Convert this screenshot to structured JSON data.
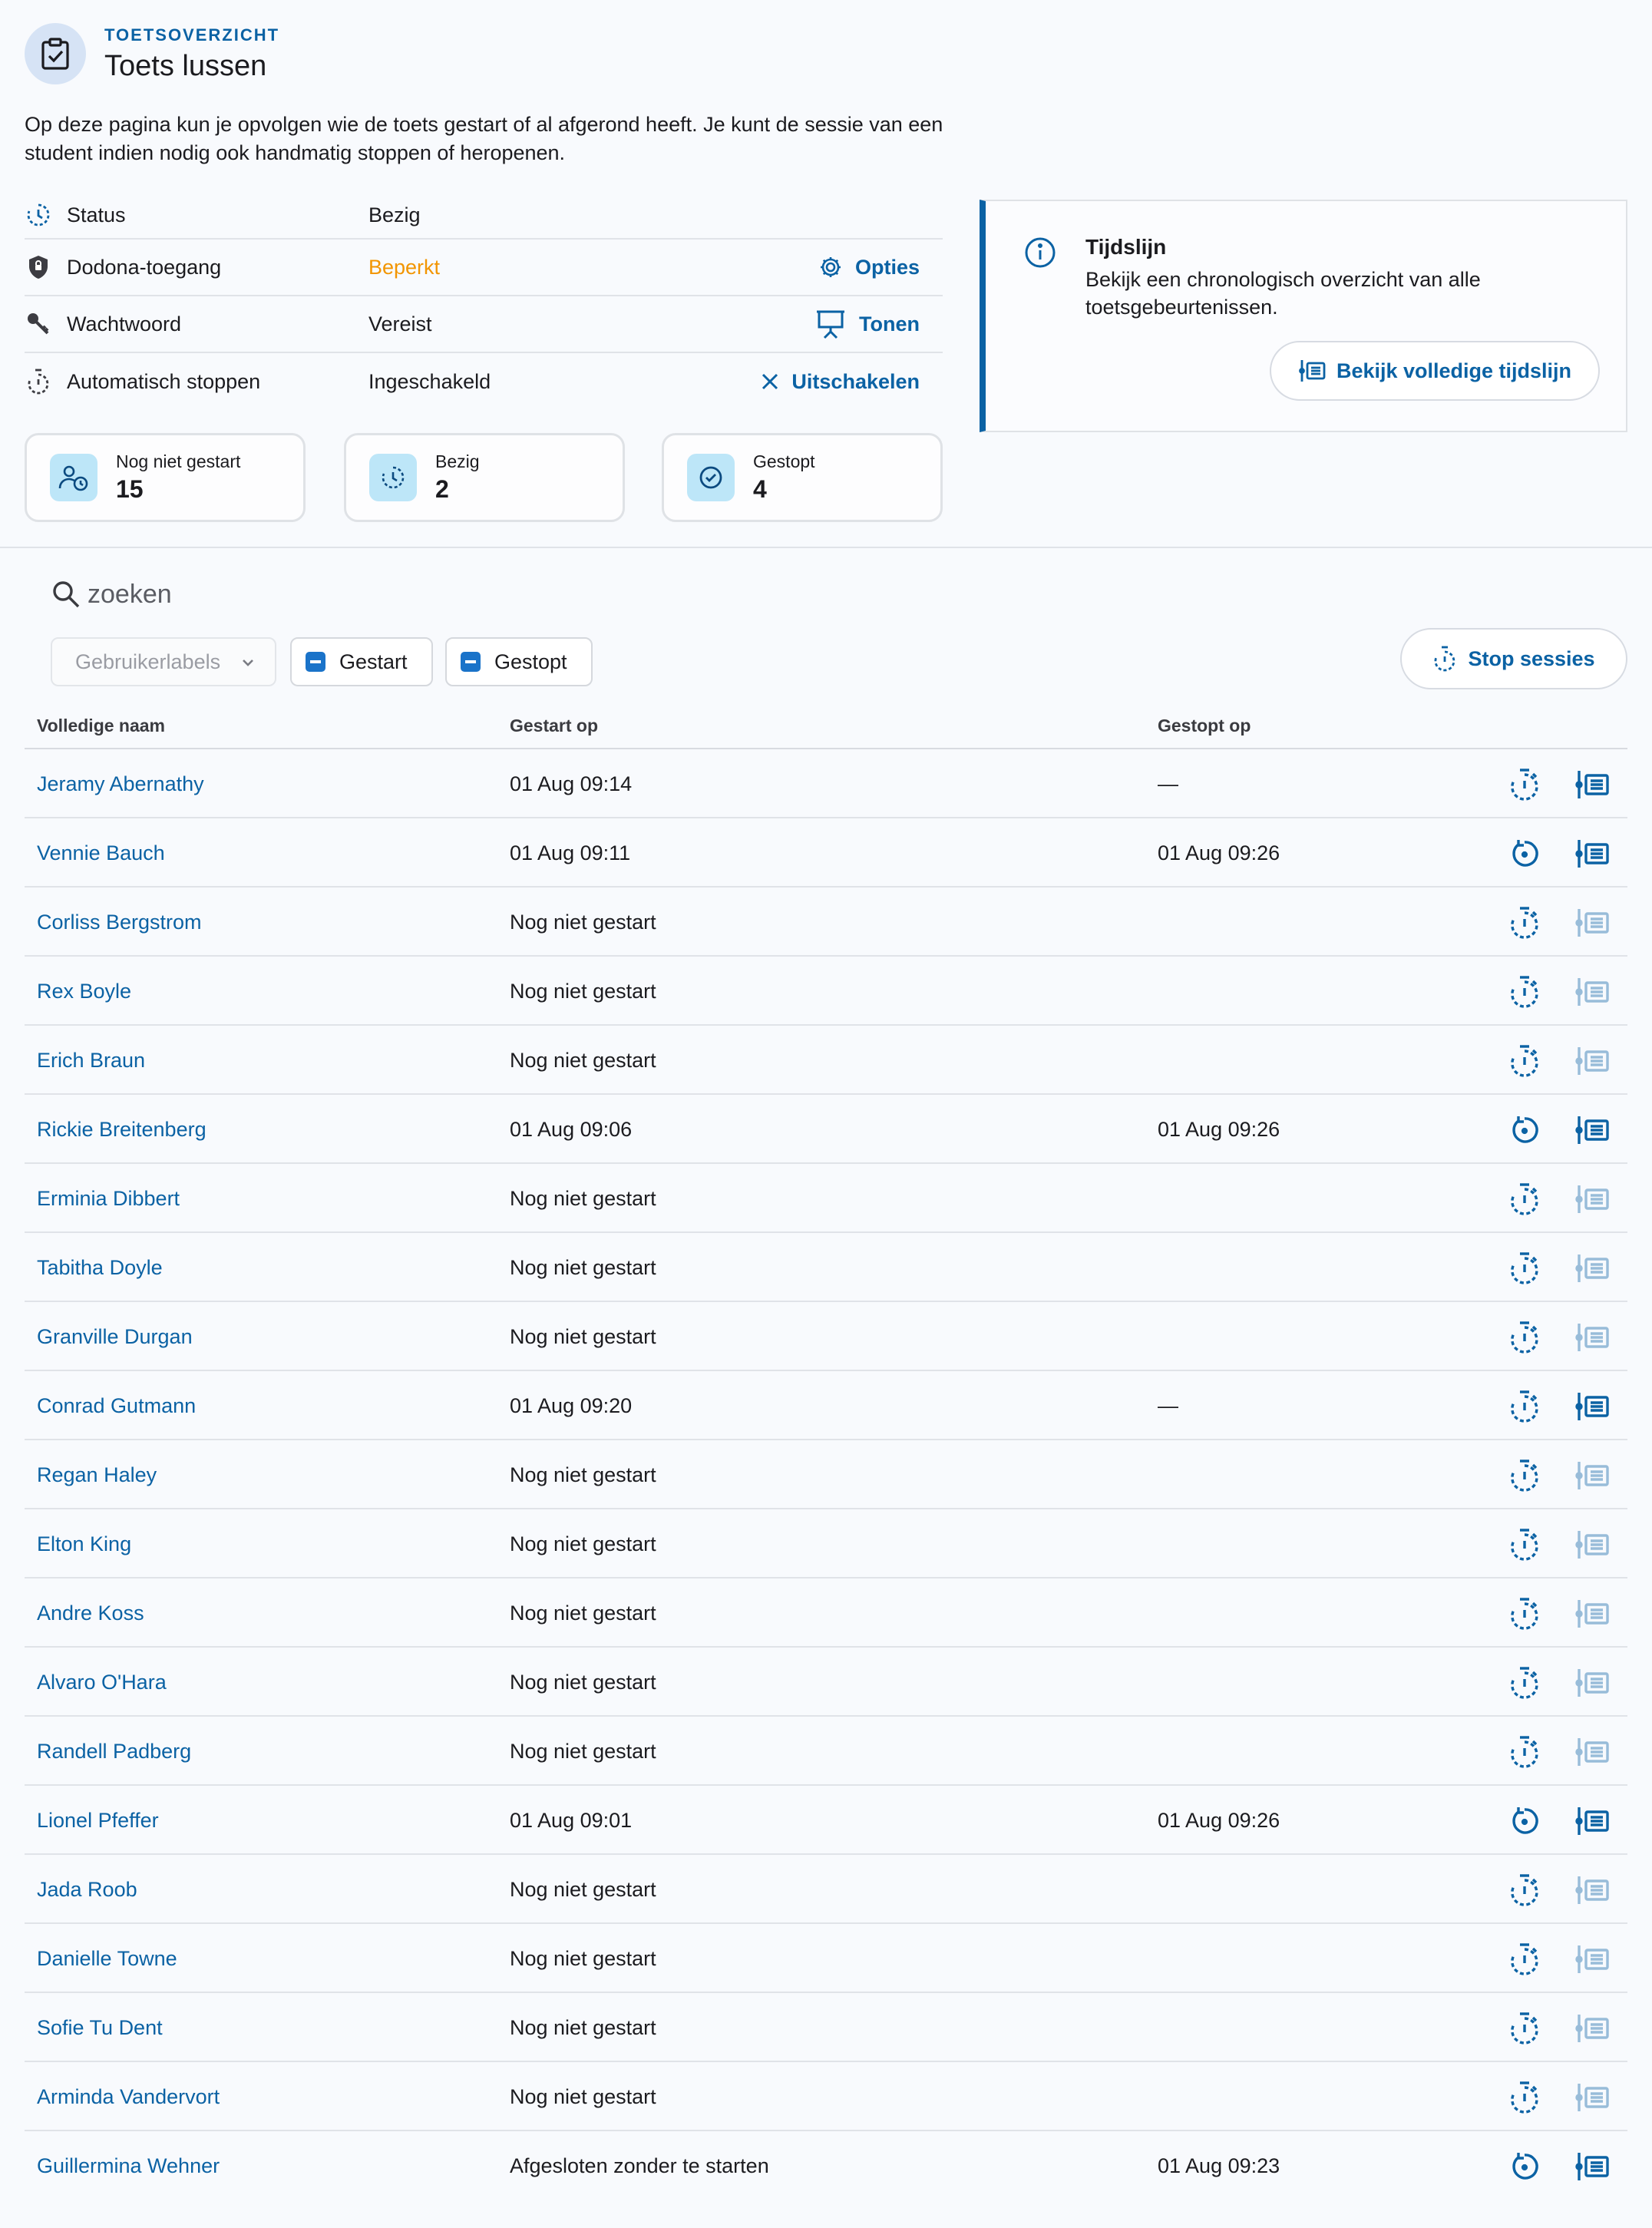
{
  "header": {
    "eyebrow": "TOETSOVERZICHT",
    "title": "Toets lussen",
    "intro": "Op deze pagina kun je opvolgen wie de toets gestart of al afgerond heeft. Je kunt de sessie van een student indien nodig ook handmatig stoppen of heropenen."
  },
  "settings": {
    "status": {
      "label": "Status",
      "value": "Bezig"
    },
    "access": {
      "label": "Dodona-toegang",
      "value": "Beperkt",
      "action": "Opties"
    },
    "password": {
      "label": "Wachtwoord",
      "value": "Vereist",
      "action": "Tonen"
    },
    "autostop": {
      "label": "Automatisch stoppen",
      "value": "Ingeschakeld",
      "action": "Uitschakelen"
    }
  },
  "stats": {
    "not_started": {
      "label": "Nog niet gestart",
      "count": "15"
    },
    "busy": {
      "label": "Bezig",
      "count": "2"
    },
    "stopped": {
      "label": "Gestopt",
      "count": "4"
    }
  },
  "timeline": {
    "title": "Tijdslijn",
    "description": "Bekijk een chronologisch overzicht van alle toetsgebeurtenissen.",
    "button": "Bekijk volledige tijdslijn"
  },
  "filters": {
    "search_placeholder": "zoeken",
    "labels_placeholder": "Gebruikerlabels",
    "chip_started": "Gestart",
    "chip_stopped": "Gestopt",
    "stop_button": "Stop sessies"
  },
  "table": {
    "headers": {
      "name": "Volledige naam",
      "started": "Gestart op",
      "stopped": "Gestopt op"
    },
    "rows": [
      {
        "name": "Jeramy Abernathy",
        "started": "01 Aug 09:14",
        "stopped": "—",
        "action": "stop",
        "events": true
      },
      {
        "name": "Vennie Bauch",
        "started": "01 Aug 09:11",
        "stopped": "01 Aug 09:26",
        "action": "reopen",
        "events": true
      },
      {
        "name": "Corliss Bergstrom",
        "started": "Nog niet gestart",
        "stopped": "",
        "action": "stop",
        "events": false
      },
      {
        "name": "Rex Boyle",
        "started": "Nog niet gestart",
        "stopped": "",
        "action": "stop",
        "events": false
      },
      {
        "name": "Erich Braun",
        "started": "Nog niet gestart",
        "stopped": "",
        "action": "stop",
        "events": false
      },
      {
        "name": "Rickie Breitenberg",
        "started": "01 Aug 09:06",
        "stopped": "01 Aug 09:26",
        "action": "reopen",
        "events": true
      },
      {
        "name": "Erminia Dibbert",
        "started": "Nog niet gestart",
        "stopped": "",
        "action": "stop",
        "events": false
      },
      {
        "name": "Tabitha Doyle",
        "started": "Nog niet gestart",
        "stopped": "",
        "action": "stop",
        "events": false
      },
      {
        "name": "Granville Durgan",
        "started": "Nog niet gestart",
        "stopped": "",
        "action": "stop",
        "events": false
      },
      {
        "name": "Conrad Gutmann",
        "started": "01 Aug 09:20",
        "stopped": "—",
        "action": "stop",
        "events": true
      },
      {
        "name": "Regan Haley",
        "started": "Nog niet gestart",
        "stopped": "",
        "action": "stop",
        "events": false
      },
      {
        "name": "Elton King",
        "started": "Nog niet gestart",
        "stopped": "",
        "action": "stop",
        "events": false
      },
      {
        "name": "Andre Koss",
        "started": "Nog niet gestart",
        "stopped": "",
        "action": "stop",
        "events": false
      },
      {
        "name": "Alvaro O'Hara",
        "started": "Nog niet gestart",
        "stopped": "",
        "action": "stop",
        "events": false
      },
      {
        "name": "Randell Padberg",
        "started": "Nog niet gestart",
        "stopped": "",
        "action": "stop",
        "events": false
      },
      {
        "name": "Lionel Pfeffer",
        "started": "01 Aug 09:01",
        "stopped": "01 Aug 09:26",
        "action": "reopen",
        "events": true
      },
      {
        "name": "Jada Roob",
        "started": "Nog niet gestart",
        "stopped": "",
        "action": "stop",
        "events": false
      },
      {
        "name": "Danielle Towne",
        "started": "Nog niet gestart",
        "stopped": "",
        "action": "stop",
        "events": false
      },
      {
        "name": "Sofie Tu Dent",
        "started": "Nog niet gestart",
        "stopped": "",
        "action": "stop",
        "events": false
      },
      {
        "name": "Arminda Vandervort",
        "started": "Nog niet gestart",
        "stopped": "",
        "action": "stop",
        "events": false
      },
      {
        "name": "Guillermina Wehner",
        "started": "Afgesloten zonder te starten",
        "stopped": "01 Aug 09:23",
        "action": "reopen",
        "events": true
      }
    ]
  },
  "colors": {
    "accent": "#0b62a4",
    "warning": "#f29500",
    "icon_bg": "#bde6f8"
  }
}
